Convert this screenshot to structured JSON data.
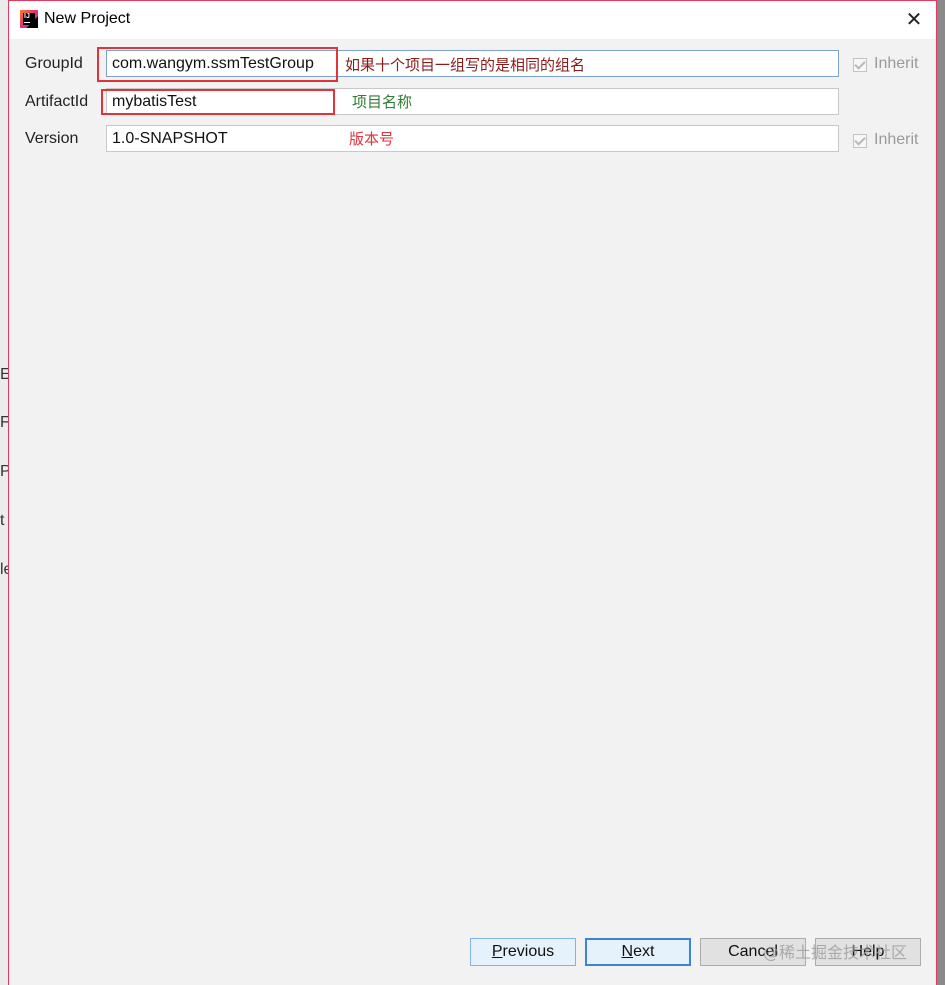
{
  "background_ide": {
    "letters": [
      "E",
      "Fi",
      "P",
      "t",
      "le"
    ]
  },
  "dialog": {
    "title": "New Project",
    "close_glyph": "✕"
  },
  "form": {
    "group_id": {
      "label": "GroupId",
      "value": "com.wangym.ssmTestGroup",
      "inherit_label": "Inherit",
      "inherit_checked": true
    },
    "artifact_id": {
      "label": "ArtifactId",
      "value": "mybatisTest"
    },
    "version": {
      "label": "Version",
      "value": "1.0-SNAPSHOT",
      "inherit_label": "Inherit",
      "inherit_checked": true
    }
  },
  "annotations": {
    "group_note": "如果十个项目一组写的是相同的组名",
    "artifact_note": "项目名称",
    "version_note": "版本号",
    "colors": {
      "group_note": "#8b1a1a",
      "artifact_note": "#2e7d32",
      "version_note": "#e2323a",
      "highlight_box": "#e2323a"
    }
  },
  "buttons": {
    "previous": {
      "mnemonic": "P",
      "rest": "revious"
    },
    "next": {
      "mnemonic": "N",
      "rest": "ext"
    },
    "cancel": "Cancel",
    "help": "Help"
  },
  "watermark": "@稀土掘金技术社区"
}
